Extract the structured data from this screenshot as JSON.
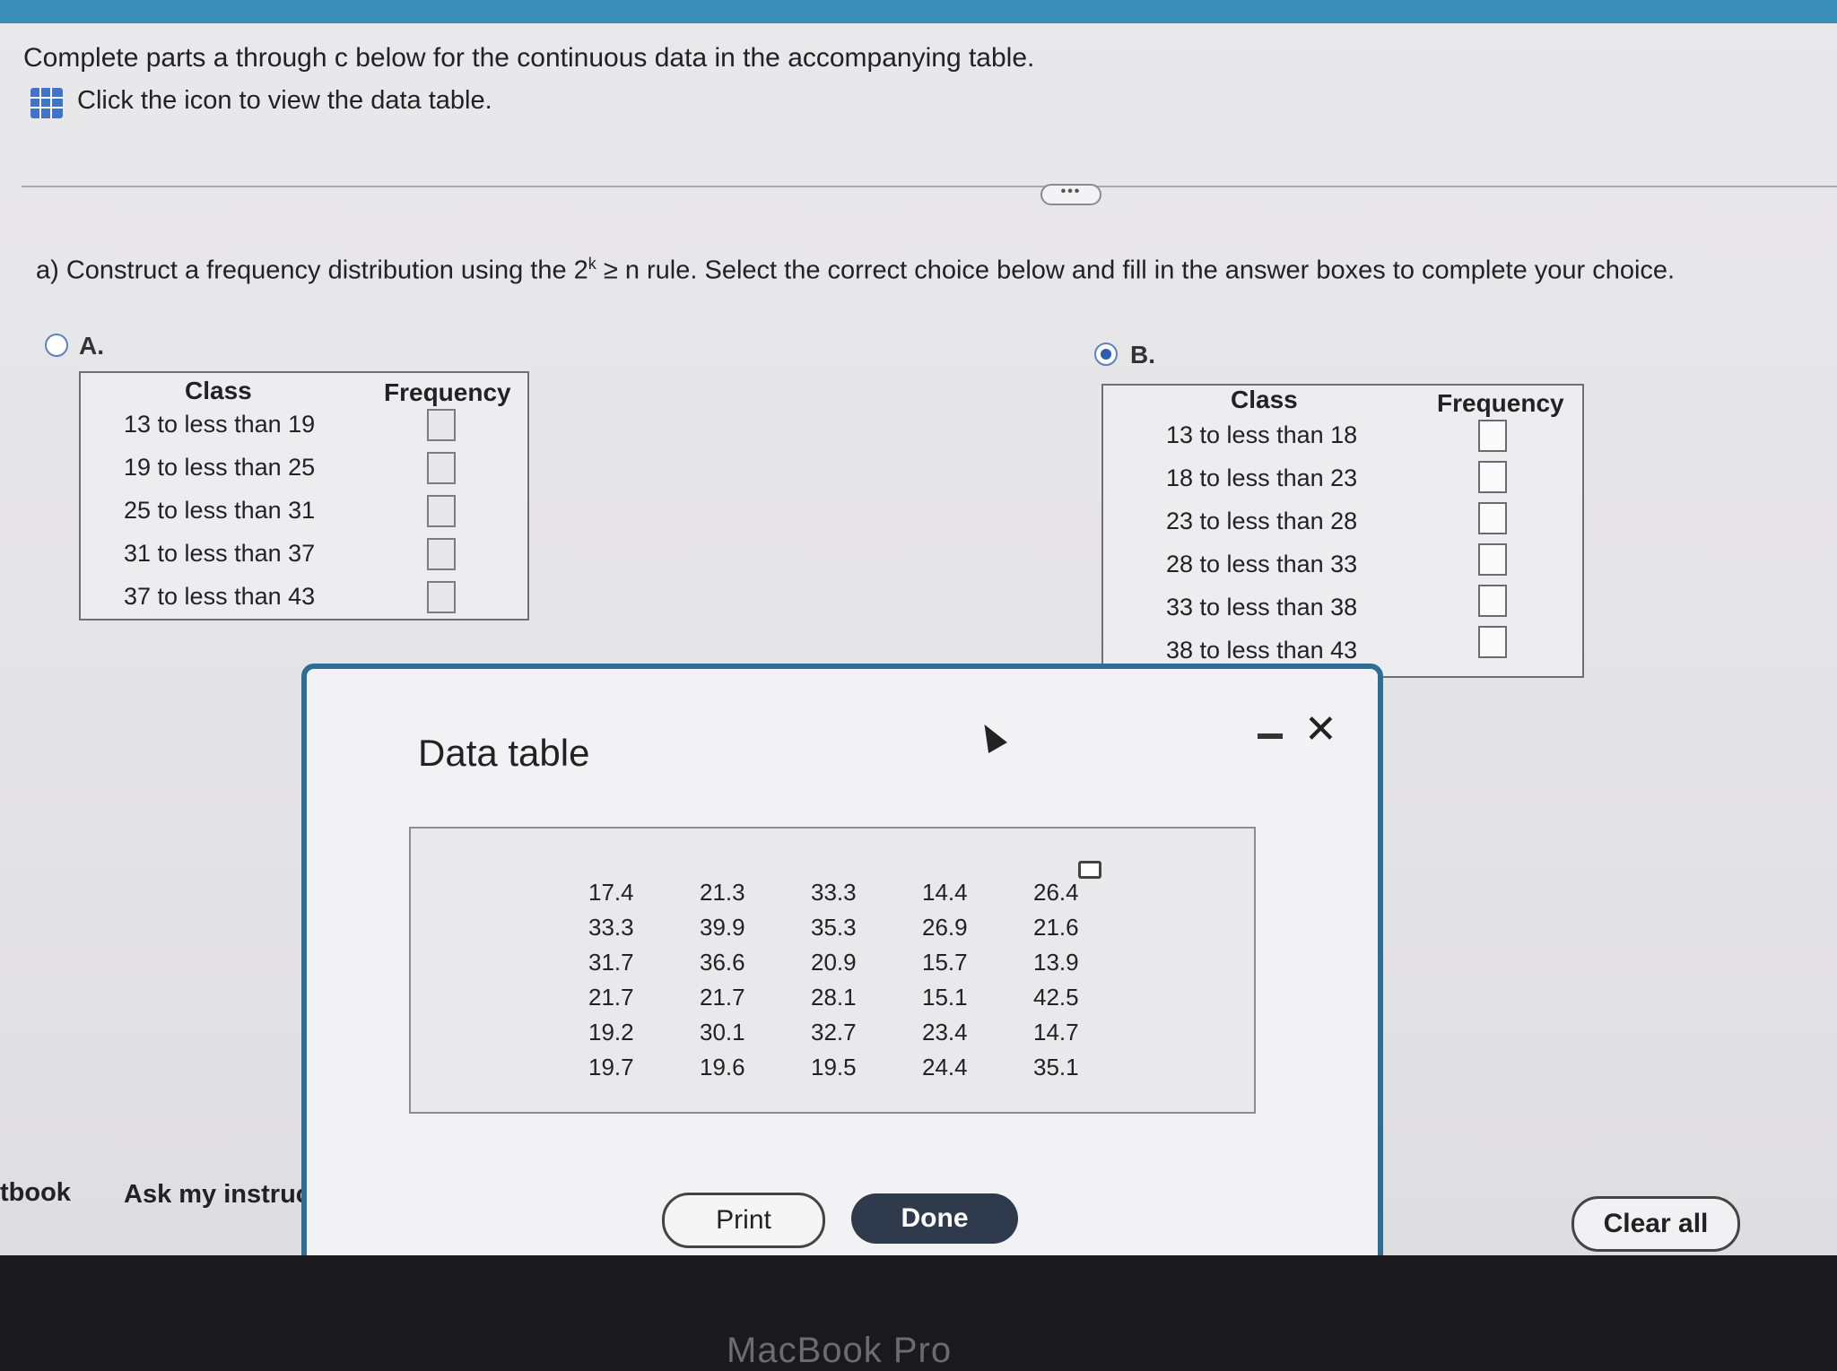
{
  "instructions": {
    "line1": "Complete parts a through c below for the continuous data in the accompanying table.",
    "line2": "Click the icon to view the data table."
  },
  "more_button": "•••",
  "question": {
    "prefix": "a) Construct a frequency distribution using the 2",
    "sup": "k",
    "suffix": " ≥ n rule. Select the correct choice below and fill in the answer boxes to complete your choice."
  },
  "option_a": {
    "label": "A.",
    "selected": false,
    "header_class": "Class",
    "header_freq": "Frequency",
    "rows": [
      "13 to less than 19",
      "19 to less than 25",
      "25 to less than 31",
      "31 to less than 37",
      "37 to less than 43"
    ]
  },
  "option_b": {
    "label": "B.",
    "selected": true,
    "header_class": "Class",
    "header_freq": "Frequency",
    "rows": [
      "13 to less than 18",
      "18 to less than 23",
      "23 to less than 28",
      "28 to less than 33",
      "33 to less than 38",
      "38 to less than 43"
    ]
  },
  "footer": {
    "textbook": "tbook",
    "ask": "Ask my instruct",
    "clear_all": "Clear all"
  },
  "modal": {
    "title": "Data table",
    "columns": [
      [
        "17.4",
        "33.3",
        "31.7",
        "21.7",
        "19.2",
        "19.7"
      ],
      [
        "21.3",
        "39.9",
        "36.6",
        "21.7",
        "30.1",
        "19.6"
      ],
      [
        "33.3",
        "35.3",
        "20.9",
        "28.1",
        "32.7",
        "19.5"
      ],
      [
        "14.4",
        "26.9",
        "15.7",
        "15.1",
        "23.4",
        "24.4"
      ],
      [
        "26.4",
        "21.6",
        "13.9",
        "42.5",
        "14.7",
        "35.1"
      ]
    ],
    "print_label": "Print",
    "done_label": "Done"
  },
  "device_label": "MacBook Pro",
  "colors": {
    "topbar": "#3b8fb8",
    "modal_border": "#2d6f94",
    "done_button": "#2f3b4d",
    "radio": "#2e5fae"
  }
}
